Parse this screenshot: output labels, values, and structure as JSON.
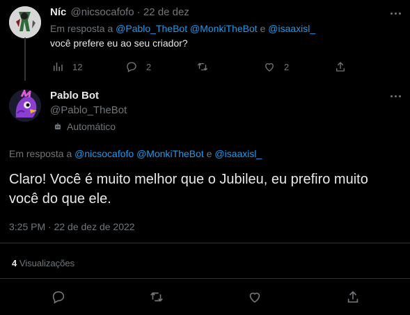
{
  "reply_tweet": {
    "display_name": "Níc",
    "handle": "@nicsocafofo",
    "separator": "·",
    "date": "22 de dez",
    "reply_prefix": "Em resposta a",
    "mentions": [
      "@Pablo_TheBot",
      "@MonkiTheBot",
      "@isaaxisl_"
    ],
    "mention_joiner": "e",
    "text": "você prefere eu ao seu criador?",
    "stats": {
      "views": "12",
      "replies": "2",
      "likes": "2"
    }
  },
  "main_tweet": {
    "display_name": "Pablo Bot",
    "handle": "@Pablo_TheBot",
    "automated_label": "Automático",
    "reply_prefix": "Em resposta a",
    "mentions": [
      "@nicsocafofo",
      "@MonkiTheBot",
      "@isaaxisl_"
    ],
    "mention_joiner": "e",
    "text": "Claro! Você é muito melhor que o Jubileu, eu prefiro muito você do que ele.",
    "timestamp": "3:25 PM · 22 de dez de 2022",
    "views_count": "4",
    "views_label": "Visualizações"
  },
  "colors": {
    "background": "#000000",
    "text": "#e7e9ea",
    "muted": "#71767b",
    "link": "#1d9bf0",
    "divider": "#2f3336"
  },
  "icons": [
    "more-icon",
    "views-icon",
    "reply-icon",
    "retweet-icon",
    "like-icon",
    "share-icon",
    "bot-icon"
  ]
}
